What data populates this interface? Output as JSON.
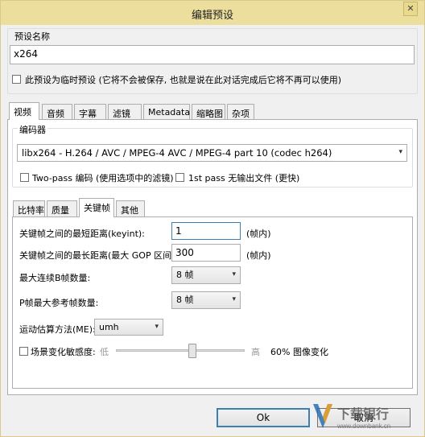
{
  "window": {
    "title": "编辑预设",
    "close_glyph": "✕"
  },
  "preset": {
    "name_label": "预设名称",
    "name_value": "x264",
    "temp_label": "此预设为临时预设 (它将不会被保存, 也就是说在此对话完成后它将不再可以使用)",
    "temp_checked": false
  },
  "main_tabs": [
    "视频",
    "音频",
    "字幕",
    "滤镜",
    "Metadata",
    "缩略图",
    "杂项"
  ],
  "main_tab_active": "视频",
  "encoder": {
    "group_label": "编码器",
    "selected": "libx264 - H.264 / AVC / MPEG-4 AVC / MPEG-4 part 10 (codec h264)",
    "arrow_glyph": "▾",
    "twopass_label": "Two-pass 编码 (使用选项中的滤镜)",
    "firstpass_label": "1st pass 无输出文件 (更快)"
  },
  "sub_tabs": [
    "比特率",
    "质量",
    "关键帧",
    "其他"
  ],
  "sub_tab_active": "关键帧",
  "keyframes": {
    "min_label": "关键帧之间的最短距离(keyint):",
    "min_value": "1",
    "max_label": "关键帧之间的最长距离(最大 GOP 区间):",
    "max_value": "300",
    "unit": "(帧内)",
    "bframes_label": "最大连续B帧数量:",
    "bframes_value": "8 帧",
    "refs_label": "P帧最大参考帧数量:",
    "refs_value": "8 帧",
    "me_label": "运动估算方法(ME):",
    "me_value": "umh",
    "scene_label": "场景变化敏感度:",
    "scene_checked": false,
    "scene_low": "低",
    "scene_high": "高",
    "scene_readout": "60% 图像变化",
    "scene_level": 0.6
  },
  "buttons": {
    "ok": "Ok",
    "cancel": "取消"
  },
  "watermark": {
    "brand": "下载银行",
    "url": "www.downbank.cn"
  }
}
